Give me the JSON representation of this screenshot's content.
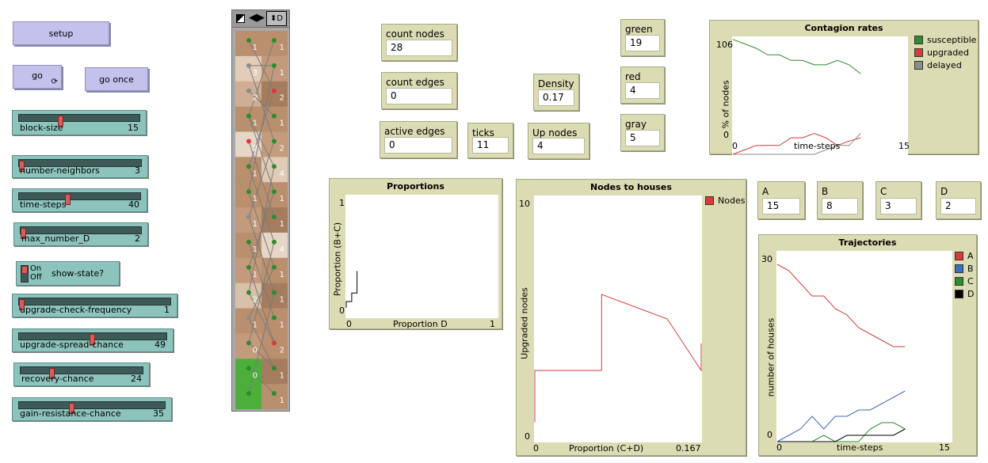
{
  "buttons": {
    "setup": "setup",
    "go": "go",
    "go_once": "go once"
  },
  "sliders": [
    {
      "label": "block-size",
      "value": "15",
      "fraction": 0.33
    },
    {
      "label": "number-neighbors",
      "value": "3",
      "fraction": 0.0
    },
    {
      "label": "time-steps",
      "value": "40",
      "fraction": 0.39
    },
    {
      "label": "max_number_D",
      "value": "2",
      "fraction": 0.0
    },
    {
      "label": "upgrade-check-frequency",
      "value": "1",
      "fraction": 0.0
    },
    {
      "label": "upgrade-spread-chance",
      "value": "49",
      "fraction": 0.49
    },
    {
      "label": "recovery-chance",
      "value": "24",
      "fraction": 0.24
    },
    {
      "label": "gain-resistance-chance",
      "value": "35",
      "fraction": 0.35
    }
  ],
  "switch": {
    "on": "On",
    "off": "Off",
    "label": "show-state?"
  },
  "view": {
    "right_letter": "D",
    "left_labels": [
      "1",
      "3",
      "2",
      "1",
      "2",
      "1",
      "1",
      "1",
      "1",
      "1",
      "2",
      "1",
      "0",
      "0"
    ],
    "right_labels": [
      "1",
      "1",
      "2",
      "1",
      "2",
      "4",
      "1",
      "1",
      "4",
      "1",
      "1",
      "1",
      "2",
      "1",
      "1"
    ]
  },
  "monitors": {
    "count_nodes": {
      "label": "count nodes",
      "value": "28"
    },
    "count_edges": {
      "label": "count edges",
      "value": "0"
    },
    "active_edges": {
      "label": "active edges",
      "value": "0"
    },
    "ticks": {
      "label": "ticks",
      "value": "11"
    },
    "density": {
      "label": "Density",
      "value": "0.17"
    },
    "up_nodes": {
      "label": "Up nodes",
      "value": "4"
    },
    "green": {
      "label": "green",
      "value": "19"
    },
    "red": {
      "label": "red",
      "value": "4"
    },
    "gray": {
      "label": "gray",
      "value": "5"
    },
    "A": {
      "label": "A",
      "value": "15"
    },
    "B": {
      "label": "B",
      "value": "8"
    },
    "C": {
      "label": "C",
      "value": "3"
    },
    "D": {
      "label": "D",
      "value": "2"
    }
  },
  "colors": {
    "green": "#2e8b2e",
    "red": "#d93a3a",
    "gray": "#8c8c8c",
    "blue": "#3d6cc0",
    "black": "#000000"
  },
  "chart_data": [
    {
      "type": "line",
      "title": "Contagion rates",
      "xlabel": "time-steps",
      "ylabel": "% of nodes",
      "xlim": [
        0,
        15
      ],
      "ylim": [
        0,
        106
      ],
      "xtick_labels": [
        "0",
        "15"
      ],
      "ytick_labels": [
        "0",
        "106"
      ],
      "series": [
        {
          "name": "susceptible",
          "color": "#2e8b2e",
          "x": [
            0,
            1,
            2,
            3,
            4,
            5,
            6,
            7,
            8,
            9,
            10,
            11
          ],
          "y": [
            104,
            100,
            96,
            90,
            90,
            85,
            85,
            81,
            81,
            85,
            81,
            73
          ]
        },
        {
          "name": "upgraded",
          "color": "#d93a3a",
          "x": [
            0,
            1,
            2,
            3,
            4,
            5,
            6,
            7,
            8,
            9,
            10,
            11
          ],
          "y": [
            0,
            4,
            8,
            8,
            8,
            15,
            15,
            19,
            15,
            8,
            12,
            15
          ]
        },
        {
          "name": "delayed",
          "color": "#8c8c8c",
          "x": [
            0,
            1,
            2,
            3,
            4,
            5,
            6,
            7,
            8,
            9,
            10,
            11
          ],
          "y": [
            0,
            0,
            0,
            0,
            0,
            0,
            0,
            0,
            4,
            8,
            8,
            19
          ]
        }
      ]
    },
    {
      "type": "line",
      "title": "Proportions",
      "xlabel": "Proportion D",
      "ylabel": "Proportion (B+C)",
      "xlim": [
        0,
        1
      ],
      "ylim": [
        0,
        1
      ],
      "xtick_labels": [
        "0",
        "1"
      ],
      "ytick_labels": [
        "0",
        "1"
      ],
      "series": [
        {
          "name": "",
          "color": "#000000",
          "x": [
            0,
            0,
            0.036,
            0.036,
            0.071,
            0.071,
            0.071,
            0.071
          ],
          "y": [
            0.08,
            0.13,
            0.13,
            0.2,
            0.2,
            0.33,
            0.38,
            0.38
          ]
        }
      ]
    },
    {
      "type": "line",
      "title": "Nodes to houses",
      "xlabel": "Proportion (C+D)",
      "ylabel": "Upgraded nodes",
      "xlim": [
        0,
        0.167
      ],
      "ylim": [
        0,
        10
      ],
      "xtick_labels": [
        "0",
        "0.167"
      ],
      "ytick_labels": [
        "0",
        "10"
      ],
      "series": [
        {
          "name": "Nodes",
          "color": "#d93a3a",
          "x": [
            0,
            0,
            0.05,
            0.067,
            0.067,
            0.133,
            0.167,
            0.167
          ],
          "y": [
            0.8,
            2.9,
            2.9,
            2.9,
            6.0,
            5.0,
            2.9,
            4.0
          ]
        }
      ]
    },
    {
      "type": "line",
      "title": "Trajectories",
      "xlabel": "time-steps",
      "ylabel": "number of houses",
      "xlim": [
        0,
        15
      ],
      "ylim": [
        0,
        30
      ],
      "xtick_labels": [
        "0",
        "15"
      ],
      "ytick_labels": [
        "0",
        "30"
      ],
      "series": [
        {
          "name": "A",
          "color": "#d93a3a",
          "x": [
            0,
            1,
            2,
            3,
            4,
            5,
            6,
            7,
            8,
            9,
            10,
            11
          ],
          "y": [
            28,
            27,
            25,
            23,
            23,
            21,
            20,
            18,
            17,
            16,
            15,
            15
          ]
        },
        {
          "name": "B",
          "color": "#3d6cc0",
          "x": [
            0,
            1,
            2,
            3,
            4,
            5,
            6,
            7,
            8,
            9,
            10,
            11
          ],
          "y": [
            0,
            1,
            2,
            4,
            2,
            4,
            4,
            5,
            5,
            6,
            7,
            8
          ]
        },
        {
          "name": "C",
          "color": "#2e8b2e",
          "x": [
            0,
            1,
            2,
            3,
            4,
            5,
            6,
            7,
            8,
            9,
            10,
            11
          ],
          "y": [
            0,
            0,
            0,
            0,
            1,
            0,
            0,
            0,
            2,
            3,
            3,
            2
          ]
        },
        {
          "name": "D",
          "color": "#000000",
          "x": [
            0,
            1,
            2,
            3,
            4,
            5,
            6,
            7,
            8,
            9,
            10,
            11
          ],
          "y": [
            0,
            0,
            0,
            0,
            0,
            0,
            1,
            1,
            1,
            1,
            1,
            2
          ]
        }
      ]
    }
  ]
}
